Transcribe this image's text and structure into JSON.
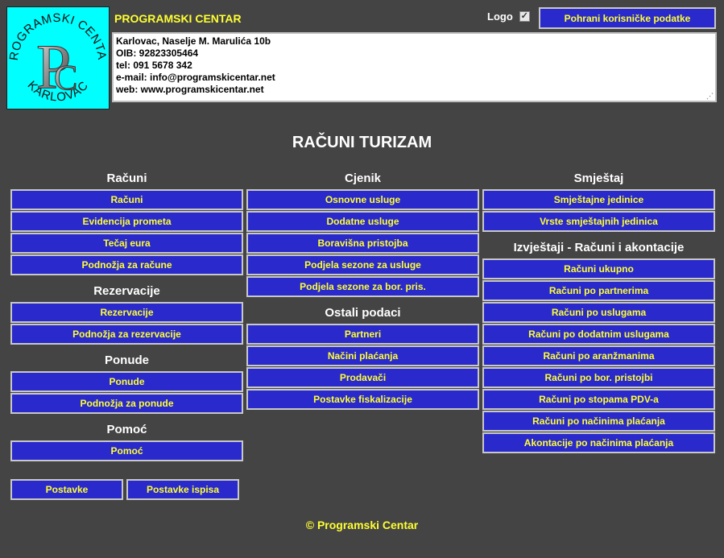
{
  "header": {
    "logo": {
      "text_top": "PROGRAMSKI CENTAR",
      "text_bottom": "KARLOVAC",
      "letter_p": "P",
      "letter_c": "C",
      "bg_color": "#00ffff"
    },
    "company_name": "PROGRAMSKI CENTAR",
    "logo_toggle_label": "Logo",
    "logo_checked": true,
    "save_button_label": "Pohrani korisničke podatke",
    "company_info_lines": [
      "Karlovac, Naselje M. Marulića 10b",
      "OIB: 92823305464",
      "tel: 091 5678 342",
      "e-mail: info@programskicentar.net",
      "web: www.programskicentar.net"
    ]
  },
  "title": "RAČUNI TURIZAM",
  "columns": {
    "left": {
      "racuni": {
        "heading": "Računi",
        "items": [
          "Računi",
          "Evidencija prometa",
          "Tečaj eura",
          "Podnožja za račune"
        ]
      },
      "rezervacije": {
        "heading": "Rezervacije",
        "items": [
          "Rezervacije",
          "Podnožja za rezervacije"
        ]
      },
      "ponude": {
        "heading": "Ponude",
        "items": [
          "Ponude",
          "Podnožja za ponude"
        ]
      },
      "pomoc": {
        "heading": "Pomoć",
        "items": [
          "Pomoć"
        ]
      },
      "settings": {
        "postavke": "Postavke",
        "postavke_ispisa": "Postavke ispisa"
      }
    },
    "middle": {
      "cjenik": {
        "heading": "Cjenik",
        "items": [
          "Osnovne usluge",
          "Dodatne usluge",
          "Boravišna pristojba",
          "Podjela sezone za usluge",
          "Podjela sezone za bor. pris."
        ]
      },
      "ostali": {
        "heading": "Ostali podaci",
        "items": [
          "Partneri",
          "Načini plaćanja",
          "Prodavači",
          "Postavke fiskalizacije"
        ]
      }
    },
    "right": {
      "smjestaj": {
        "heading": "Smještaj",
        "items": [
          "Smještajne jedinice",
          "Vrste smještajnih jedinica"
        ]
      },
      "izvjestaji": {
        "heading": "Izvještaji - Računi i akontacije",
        "items": [
          "Računi ukupno",
          "Računi po partnerima",
          "Računi po uslugama",
          "Računi po dodatnim uslugama",
          "Računi po aranžmanima",
          "Računi po bor. pristojbi",
          "Računi po stopama PDV-a",
          "Računi po načinima plaćanja",
          "Akontacije po načinima plaćanja"
        ]
      }
    }
  },
  "footer": "© Programski Centar",
  "colors": {
    "background": "#444444",
    "button": "#2a2acc",
    "button_text": "#ffff33",
    "accent_text": "#ffff33"
  }
}
